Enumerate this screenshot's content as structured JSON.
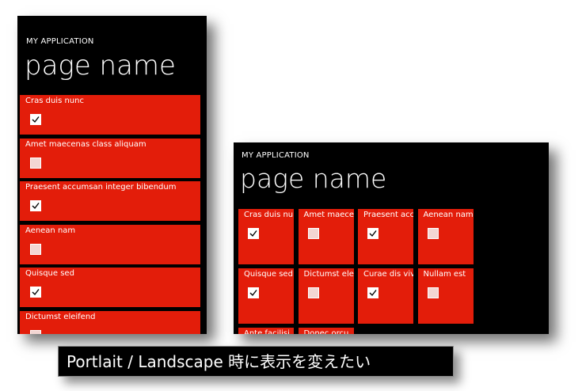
{
  "portrait": {
    "app_title": "MY APPLICATION",
    "page_title": "page name",
    "items": [
      {
        "label": "Cras duis nunc",
        "checked": true
      },
      {
        "label": "Amet maecenas class aliquam",
        "checked": false
      },
      {
        "label": "Praesent accumsan integer bibendum",
        "checked": true
      },
      {
        "label": "Aenean nam",
        "checked": false
      },
      {
        "label": "Quisque sed",
        "checked": true
      },
      {
        "label": "Dictumst eleifend",
        "checked": false
      }
    ]
  },
  "landscape": {
    "app_title": "MY APPLICATION",
    "page_title": "page name",
    "items": [
      {
        "label": "Cras duis nunc",
        "checked": true
      },
      {
        "label": "Amet maecenas",
        "checked": false
      },
      {
        "label": "Praesent accum",
        "checked": true
      },
      {
        "label": "Aenean nam",
        "checked": false
      },
      {
        "label": "Quisque sed",
        "checked": true
      },
      {
        "label": "Dictumst eleifen",
        "checked": false
      },
      {
        "label": "Curae dis vivam",
        "checked": true
      },
      {
        "label": "Nullam est",
        "checked": false
      },
      {
        "label": "Ante facilisi",
        "checked": false
      },
      {
        "label": "Donec orcu",
        "checked": false
      }
    ]
  },
  "caption": "Portlait / Landscape 時に表示を変えたい",
  "colors": {
    "accent": "#e31d0a",
    "background": "#000000"
  }
}
